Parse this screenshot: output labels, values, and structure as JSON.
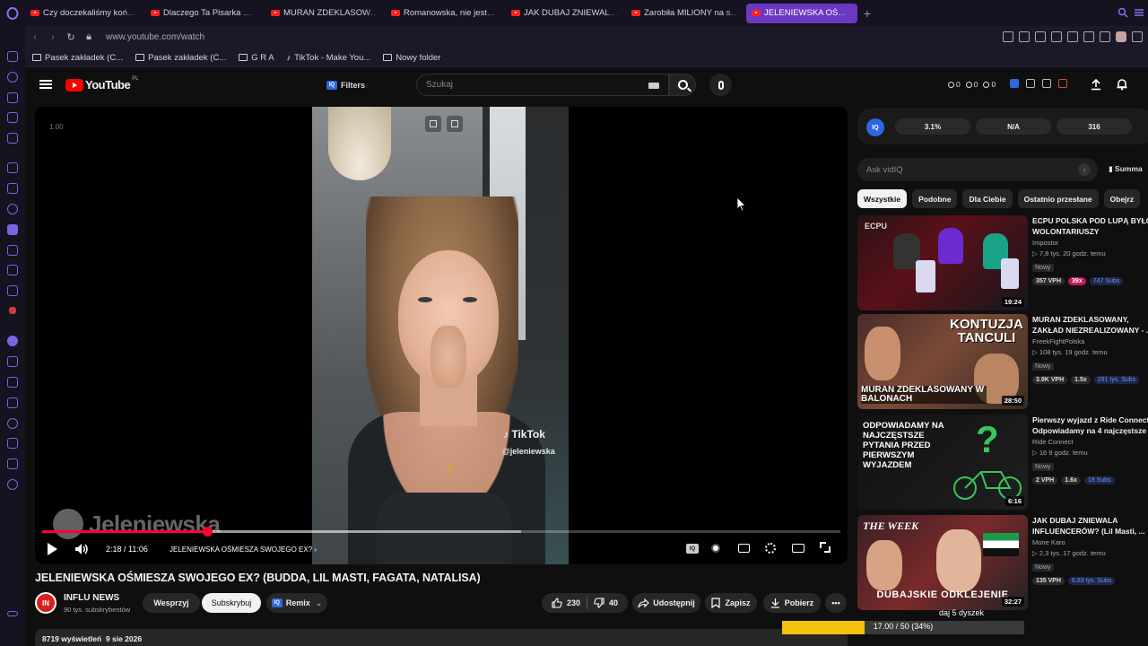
{
  "browser": {
    "tabs": [
      {
        "title": "Czy doczekaliśmy końca U",
        "active": false
      },
      {
        "title": "Dlaczego Ta Pisarka WKUR",
        "active": false
      },
      {
        "title": "MURAN ZDEKLASOWANY,",
        "active": false
      },
      {
        "title": "Romanowska, nie jesteś an",
        "active": false
      },
      {
        "title": "JAK DUBAJ ZNIEWALA INF",
        "active": false
      },
      {
        "title": "Zarobiła MILIONY na skand",
        "active": false
      },
      {
        "title": "JELENIEWSKA OŚMIESZA",
        "active": true
      }
    ],
    "new_tab": "+",
    "url": "www.youtube.com/watch",
    "bookmarks": [
      {
        "label": "Pasek zakładek (C...",
        "icon": "folder-icon"
      },
      {
        "label": "Pasek zakładek (C...",
        "icon": "folder-icon"
      },
      {
        "label": "G R A",
        "icon": "folder-icon"
      },
      {
        "label": "TikTok - Make You...",
        "icon": "tiktok-icon"
      },
      {
        "label": "Nowy folder",
        "icon": "folder-icon"
      }
    ]
  },
  "header": {
    "logo_text": "YouTube",
    "country_code": "PL",
    "filters_label": "Filters",
    "search_placeholder": "Szukaj",
    "stats": [
      "0",
      "0",
      "0"
    ]
  },
  "player": {
    "speed": "1.00",
    "watermark_handle": "@jeleniewska",
    "watermark_brand": "TikTok",
    "channel_watermark": "Jeleniewska",
    "time": "2:18 / 11:06",
    "chapter": "JELENIEWSKA OŚMIESZA SWOJEGO EX?",
    "progress_fraction": 0.207,
    "buffer_fraction": 0.6,
    "iq_label": "IQ"
  },
  "video": {
    "title": "JELENIEWSKA OŚMIESZA SWOJEGO EX? (BUDDA, LIL MASTI, FAGATA, NATALISA)",
    "channel_name": "INFLU NEWS",
    "channel_subs": "90 tys. subskrybentów",
    "support_label": "Wesprzyj",
    "subscribe_label": "Subskrybuj",
    "remix_label": "Remix",
    "likes": "230",
    "dislikes": "40",
    "share_label": "Udostępnij",
    "save_label": "Zapisz",
    "download_label": "Pobierz",
    "views": "8719 wyświetleń",
    "date": "9 sie 2026"
  },
  "vidiq": {
    "logo": "IQ",
    "stats": [
      "3.1%",
      "N/A",
      "316"
    ],
    "ask_placeholder": "Ask vidIQ",
    "summary_label": "Summa"
  },
  "chips": [
    "Wszystkie",
    "Podobne",
    "Dla Ciebie",
    "Ostatnio przesłane",
    "Obejrz"
  ],
  "recommendations": [
    {
      "title": "ECPU POLSKA POD LUPĄ BYŁCH WOLONTARIUSZY",
      "channel": "Impostor",
      "views": "▷ 7,8 tys.  20 godz. temu",
      "badge": "Nowy",
      "vph": "357 VPH",
      "mult": "39x",
      "subs": "747 Subs",
      "duration": "19:24",
      "thumb_text": "ECPU"
    },
    {
      "title": "MURAN ZDEKLASOWANY, ZAKŁAD NIEZREALIZOWANY - ...",
      "channel": "FreekFightPolska",
      "views": "▷ 108 tys.  19 godz. temu",
      "badge": "Nowy",
      "vph": "3.9K VPH",
      "mult": "1.5x",
      "subs": "291 tys. Subs",
      "duration": "28:50",
      "thumb_text": "KONTUZJA TANCULI",
      "thumb_text2": "MURAN ZDEKLASOWANY W BALONACH"
    },
    {
      "title": "Pierwszy wyjazd z Ride Connect? Odpowiadamy na 4 najczęstsze ...",
      "channel": "Ride Connect",
      "views": "▷ 16  9 godz. temu",
      "badge": "Nowy",
      "vph": "2 VPH",
      "mult": "1.6x",
      "subs": "18 Subs",
      "duration": "6:16",
      "thumb_text": "ODPOWIADAMY NA NAJCZĘSTSZE PYTANIA PRZED PIERWSZYM WYJAZDEM"
    },
    {
      "title": "JAK DUBAJ ZNIEWALA INFLUENCERÓW? (Lil Masti, ...",
      "channel": "Mone Karo",
      "views": "▷ 2,3 tys.  17 godz. temu",
      "badge": "Nowy",
      "vph": "135 VPH",
      "mult": "",
      "subs": "6.83 tys. Subs",
      "duration": "32:27",
      "thumb_text": "DUBAJSKIE ODKLEJENIE",
      "thumb_brand": "THE WEEK"
    }
  ],
  "download": {
    "label": "daj 5 dyszek",
    "progress_text": "17.00 / 50 (34%)",
    "fraction": 0.34
  },
  "colors": {
    "accent": "#6a38c2",
    "youtube_red": "#ff0000",
    "progress": "#ff0033",
    "download": "#f4c10f"
  }
}
